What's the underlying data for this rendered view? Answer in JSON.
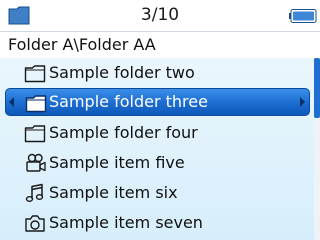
{
  "status": {
    "folder_icon": "folder-icon",
    "counter": "3/10",
    "battery_icon": "battery-icon",
    "battery_level": 1.0
  },
  "path": {
    "text": "Folder A\\Folder AA"
  },
  "list": {
    "selected_index": 1,
    "items": [
      {
        "label": "Sample folder two",
        "icon": "folder-icon"
      },
      {
        "label": "Sample folder three",
        "icon": "folder-icon"
      },
      {
        "label": "Sample folder four",
        "icon": "folder-icon"
      },
      {
        "label": "Sample item five",
        "icon": "video-icon"
      },
      {
        "label": "Sample item six",
        "icon": "music-note-icon"
      },
      {
        "label": "Sample item seven",
        "icon": "camera-icon"
      }
    ]
  },
  "colors": {
    "selection": "#1e6fd3",
    "list_background": "#e2f3fc",
    "scroll_thumb": "#1f6fd1"
  }
}
